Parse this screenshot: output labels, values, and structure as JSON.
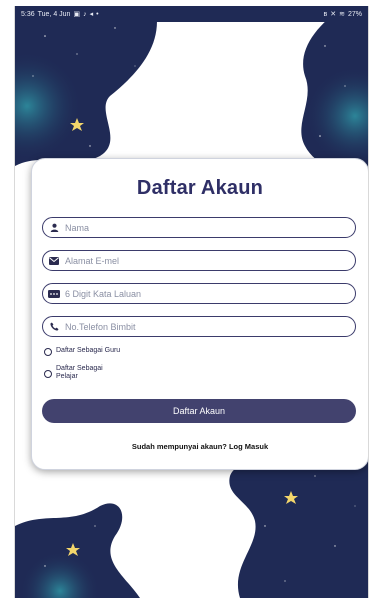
{
  "status_bar": {
    "time": "5:36",
    "date": "Tue, 4 Jun",
    "icons_left": [
      "gallery-icon",
      "tiktok-icon",
      "send-icon",
      "dot-icon"
    ],
    "icons_right": [
      "bluetooth-icon",
      "mute-icon",
      "signal-icon"
    ],
    "battery": "27%"
  },
  "form": {
    "title": "Daftar Akaun",
    "fields": [
      {
        "placeholder": "Nama",
        "icon": "person-icon"
      },
      {
        "placeholder": "Alamat E-mel",
        "icon": "mail-icon"
      },
      {
        "placeholder": "6 Digit Kata Laluan",
        "icon": "password-icon"
      },
      {
        "placeholder": "No.Telefon Bimbit",
        "icon": "phone-icon"
      }
    ],
    "radios": [
      {
        "label": "Daftar Sebagai Guru"
      },
      {
        "label_line1": "Daftar Sebagai",
        "label_line2": "Pelajar"
      }
    ],
    "submit_label": "Daftar Akaun",
    "login_prompt": "Sudah mempunyai akaun? Log Masuk"
  },
  "colors": {
    "primary": "#42426e",
    "title": "#2f2f66",
    "night_sky": "#1f2a55",
    "teal_glow": "#2e8fa0",
    "star": "#f3d66b"
  }
}
